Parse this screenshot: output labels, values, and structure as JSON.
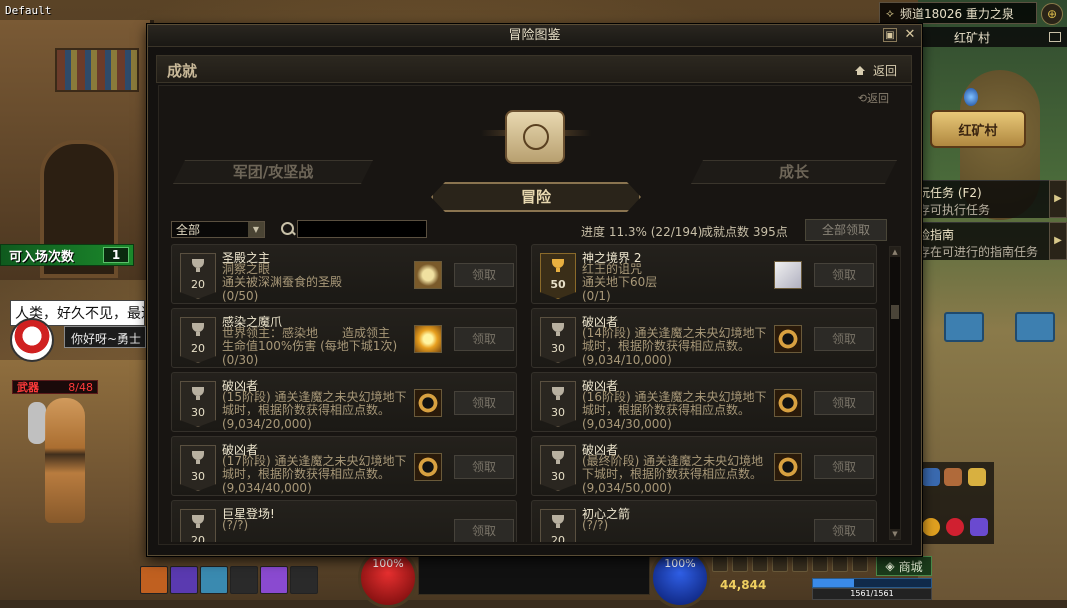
{
  "hud": {
    "default_label": "Default",
    "entry_count_label": "可入场次数",
    "entry_count_value": "1",
    "chat_line": "人类，好久不见，最近",
    "speech_line": "你好呀~勇士",
    "weapon_label": "武器",
    "weapon_value": "8/48",
    "channel_text": "频道18026 重力之泉",
    "map_name": "红矿村",
    "village_sign": "红矿村",
    "quest1_title": "玩任务 (F2)",
    "quest1_desc": "存可执行任务",
    "quest2_title": "险指南",
    "quest2_desc": "存在可进行的指南任务",
    "hp_orb": "100%",
    "mp_orb": "100%",
    "shop_label": "商城",
    "gold": "44,844",
    "exp_progress": 0.35,
    "hp_text": "1561/1561"
  },
  "modal": {
    "title": "冒险图鉴",
    "section_title": "成就",
    "back_label": "返回",
    "inner_back": "返回",
    "tabs": [
      {
        "label": "军团/攻坚战",
        "active": false
      },
      {
        "label": "冒险",
        "active": true
      },
      {
        "label": "成长",
        "active": false
      }
    ],
    "filter_value": "全部",
    "search_placeholder": "",
    "progress_text": "进度 11.3% (22/194)",
    "points_text": "成就点数 395点",
    "claim_all_label": "全部领取",
    "claim_label": "领取",
    "achievements": [
      {
        "name": "圣殿之主",
        "desc": "洞察之眼\n通关被深渊蚕食的圣殿",
        "count": "(0/50)",
        "points": "20",
        "gold": false,
        "reward": "box"
      },
      {
        "name": "神之境界 2",
        "desc": "红王的诅咒\n通关地下60层",
        "count": "(0/1)",
        "points": "50",
        "gold": true,
        "reward": "scroll"
      },
      {
        "name": "感染之魔爪",
        "desc": "世界领主：感染地　　造成领主\n生命值100%伤害 (每地下城1次)",
        "count": "(0/30)",
        "points": "20",
        "gold": false,
        "reward": "star"
      },
      {
        "name": "破凶者",
        "desc": "(14阶段) 通关逢魔之未央幻境地下\n城时，根据阶数获得相应点数。",
        "count": "(9,034/10,000)",
        "points": "30",
        "gold": false,
        "reward": "ring"
      },
      {
        "name": "破凶者",
        "desc": "(15阶段) 通关逢魔之未央幻境地下\n城时，根据阶数获得相应点数。",
        "count": "(9,034/20,000)",
        "points": "30",
        "gold": false,
        "reward": "ring"
      },
      {
        "name": "破凶者",
        "desc": "(16阶段) 通关逢魔之未央幻境地下\n城时，根据阶数获得相应点数。",
        "count": "(9,034/30,000)",
        "points": "30",
        "gold": false,
        "reward": "ring"
      },
      {
        "name": "破凶者",
        "desc": "(17阶段) 通关逢魔之未央幻境地下\n城时，根据阶数获得相应点数。",
        "count": "(9,034/40,000)",
        "points": "30",
        "gold": false,
        "reward": "ring"
      },
      {
        "name": "破凶者",
        "desc": "(最终阶段) 通关逢魔之未央幻境地\n下城时，根据阶数获得相应点数。",
        "count": "(9,034/50,000)",
        "points": "30",
        "gold": false,
        "reward": "ring"
      },
      {
        "name": "巨星登场!",
        "desc": "(?/?)",
        "count": "",
        "points": "20",
        "gold": false,
        "reward": ""
      },
      {
        "name": "初心之箭",
        "desc": "(?/?)",
        "count": "",
        "points": "20",
        "gold": false,
        "reward": ""
      }
    ]
  },
  "colors": {
    "modal_bg": "#141210",
    "accent_gold": "#e8b040",
    "text_primary": "#f0e8d0",
    "text_secondary": "#a89878"
  }
}
